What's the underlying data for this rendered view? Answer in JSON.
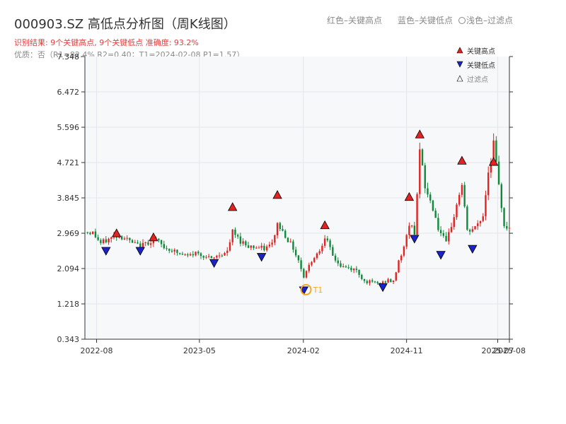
{
  "header": {
    "title": "000903.SZ 高低点分析图（周K线图）",
    "legend_red": "红色–关键高点",
    "legend_blue": "蓝色–关键低点",
    "legend_light": "浅色–过滤点",
    "result_line": "识别结果: 9个关键高点, 9个关键低点  准确度: 93.2%",
    "detail_line": "优质：否（R1=82.4%  R2=0.40；T1=2024-02-08 P1=1.57）"
  },
  "colors": {
    "up": "#e32222",
    "down": "#108a3a",
    "high_marker": "#e32222",
    "low_marker": "#1a22c8",
    "t1_ring": "#f5a623",
    "plot_bg": "#f7f8fa",
    "grid": "#e3e6ea"
  },
  "chart_data": {
    "type": "candlestick",
    "ylim": [
      0.343,
      7.348
    ],
    "yticks": [
      "0.343",
      "1.218",
      "2.094",
      "2.969",
      "3.845",
      "4.721",
      "5.596",
      "6.472",
      "7.348"
    ],
    "x_range": [
      "2022-07-01",
      "2025-08-01"
    ],
    "xticks": [
      {
        "date": "2022-08-01",
        "label": "2022-08"
      },
      {
        "date": "2023-05-01",
        "label": "2023-05"
      },
      {
        "date": "2024-02-01",
        "label": "2024-02"
      },
      {
        "date": "2024-11-01",
        "label": "2024-11"
      },
      {
        "date": "2025-07-01",
        "label": "2025-07"
      },
      {
        "date": "2025-08-01",
        "label": "2025-08"
      }
    ],
    "close_path": [
      [
        "2022-07-01",
        3.0
      ],
      [
        "2022-07-22",
        2.98
      ],
      [
        "2022-08-12",
        2.72
      ],
      [
        "2022-09-02",
        2.82
      ],
      [
        "2022-09-23",
        2.92
      ],
      [
        "2022-10-14",
        2.86
      ],
      [
        "2022-11-04",
        2.72
      ],
      [
        "2022-11-25",
        2.64
      ],
      [
        "2022-12-16",
        2.75
      ],
      [
        "2023-01-06",
        2.8
      ],
      [
        "2023-01-27",
        2.62
      ],
      [
        "2023-02-17",
        2.55
      ],
      [
        "2023-03-10",
        2.45
      ],
      [
        "2023-03-31",
        2.4
      ],
      [
        "2023-04-21",
        2.48
      ],
      [
        "2023-05-12",
        2.42
      ],
      [
        "2023-06-02",
        2.32
      ],
      [
        "2023-06-23",
        2.44
      ],
      [
        "2023-07-14",
        2.5
      ],
      [
        "2023-07-28",
        3.0
      ],
      [
        "2023-08-18",
        2.78
      ],
      [
        "2023-09-08",
        2.66
      ],
      [
        "2023-09-29",
        2.62
      ],
      [
        "2023-10-20",
        2.58
      ],
      [
        "2023-11-10",
        2.7
      ],
      [
        "2023-11-24",
        3.2
      ],
      [
        "2023-12-15",
        2.92
      ],
      [
        "2024-01-05",
        2.6
      ],
      [
        "2024-01-19",
        2.3
      ],
      [
        "2024-02-02",
        1.9
      ],
      [
        "2024-02-23",
        2.3
      ],
      [
        "2024-03-15",
        2.55
      ],
      [
        "2024-03-29",
        2.9
      ],
      [
        "2024-04-19",
        2.4
      ],
      [
        "2024-05-10",
        2.15
      ],
      [
        "2024-05-31",
        2.1
      ],
      [
        "2024-06-21",
        2.05
      ],
      [
        "2024-07-12",
        1.78
      ],
      [
        "2024-08-02",
        1.75
      ],
      [
        "2024-08-23",
        1.72
      ],
      [
        "2024-09-13",
        1.8
      ],
      [
        "2024-09-27",
        1.76
      ],
      [
        "2024-10-11",
        2.3
      ],
      [
        "2024-10-25",
        2.6
      ],
      [
        "2024-11-08",
        3.2
      ],
      [
        "2024-11-22",
        3.0
      ],
      [
        "2024-12-06",
        5.0
      ],
      [
        "2024-12-20",
        4.1
      ],
      [
        "2025-01-10",
        3.6
      ],
      [
        "2025-01-24",
        3.1
      ],
      [
        "2025-02-14",
        2.7
      ],
      [
        "2025-03-07",
        3.4
      ],
      [
        "2025-03-28",
        4.2
      ],
      [
        "2025-04-11",
        3.0
      ],
      [
        "2025-05-02",
        3.1
      ],
      [
        "2025-05-23",
        3.4
      ],
      [
        "2025-06-06",
        4.5
      ],
      [
        "2025-06-20",
        5.2
      ],
      [
        "2025-07-04",
        4.1
      ],
      [
        "2025-07-18",
        3.2
      ],
      [
        "2025-08-01",
        3.05
      ]
    ],
    "key_highs": [
      {
        "date": "2022-09-23",
        "price": 2.95
      },
      {
        "date": "2022-12-30",
        "price": 2.85
      },
      {
        "date": "2023-07-28",
        "price": 3.6
      },
      {
        "date": "2023-11-24",
        "price": 3.9
      },
      {
        "date": "2024-03-29",
        "price": 3.15
      },
      {
        "date": "2024-11-08",
        "price": 3.85
      },
      {
        "date": "2024-12-06",
        "price": 5.4
      },
      {
        "date": "2025-03-28",
        "price": 4.75
      },
      {
        "date": "2025-06-20",
        "price": 4.72
      }
    ],
    "key_lows": [
      {
        "date": "2022-08-26",
        "price": 2.55
      },
      {
        "date": "2022-11-25",
        "price": 2.55
      },
      {
        "date": "2023-06-09",
        "price": 2.25
      },
      {
        "date": "2023-10-13",
        "price": 2.4
      },
      {
        "date": "2024-02-02",
        "price": 1.57
      },
      {
        "date": "2024-08-30",
        "price": 1.65
      },
      {
        "date": "2024-11-22",
        "price": 2.85
      },
      {
        "date": "2025-01-31",
        "price": 2.45
      },
      {
        "date": "2025-04-25",
        "price": 2.6
      }
    ],
    "annotation": {
      "label": "T1",
      "date": "2024-02-08",
      "price": 1.57
    },
    "legend": [
      "关键高点",
      "关键低点",
      "过滤点"
    ],
    "legend_placement": "top-right"
  }
}
